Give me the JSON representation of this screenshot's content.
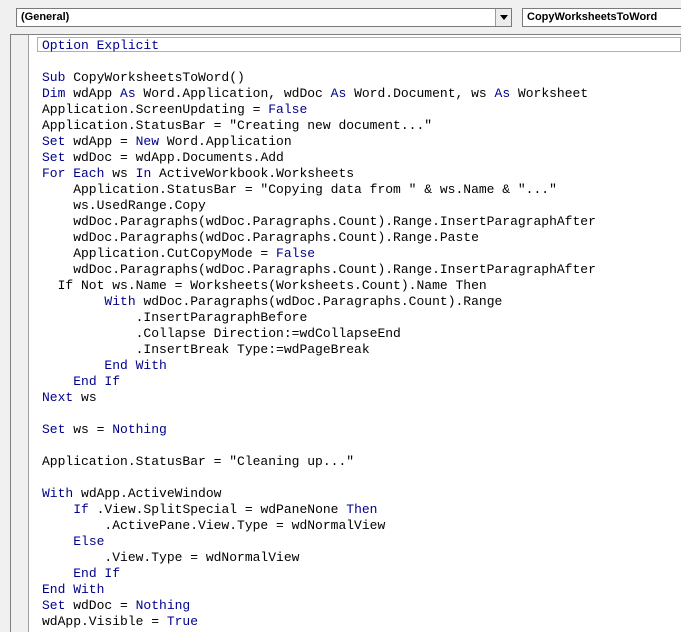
{
  "object_combo": {
    "value": "(General)"
  },
  "procedure_combo": {
    "value": "CopyWorksheetsToWord"
  },
  "colors": {
    "keyword": "#00008B",
    "text": "#000000",
    "background": "#FFFFFF"
  },
  "code_lines": [
    [
      {
        "t": "Option Explicit",
        "k": true
      }
    ],
    [],
    [
      {
        "t": "Sub",
        "k": true
      },
      {
        "t": " CopyWorksheetsToWord()"
      }
    ],
    [
      {
        "t": "Dim",
        "k": true
      },
      {
        "t": " wdApp "
      },
      {
        "t": "As",
        "k": true
      },
      {
        "t": " Word.Application, wdDoc "
      },
      {
        "t": "As",
        "k": true
      },
      {
        "t": " Word.Document, ws "
      },
      {
        "t": "As",
        "k": true
      },
      {
        "t": " Worksheet"
      }
    ],
    [
      {
        "t": "Application.ScreenUpdating = "
      },
      {
        "t": "False",
        "k": true
      }
    ],
    [
      {
        "t": "Application.StatusBar = \"Creating new document...\""
      }
    ],
    [
      {
        "t": "Set",
        "k": true
      },
      {
        "t": " wdApp = "
      },
      {
        "t": "New",
        "k": true
      },
      {
        "t": " Word.Application"
      }
    ],
    [
      {
        "t": "Set",
        "k": true
      },
      {
        "t": " wdDoc = wdApp.Documents.Add"
      }
    ],
    [
      {
        "t": "For Each",
        "k": true
      },
      {
        "t": " ws "
      },
      {
        "t": "In",
        "k": true
      },
      {
        "t": " ActiveWorkbook.Worksheets"
      }
    ],
    [
      {
        "t": "    Application.StatusBar = \"Copying data from \" & ws.Name & \"...\""
      }
    ],
    [
      {
        "t": "    ws.UsedRange.Copy"
      }
    ],
    [
      {
        "t": "    wdDoc.Paragraphs(wdDoc.Paragraphs.Count).Range.InsertParagraphAfter"
      }
    ],
    [
      {
        "t": "    wdDoc.Paragraphs(wdDoc.Paragraphs.Count).Range.Paste"
      }
    ],
    [
      {
        "t": "    Application.CutCopyMode = "
      },
      {
        "t": "False",
        "k": true
      }
    ],
    [
      {
        "t": "    wdDoc.Paragraphs(wdDoc.Paragraphs.Count).Range.InsertParagraphAfter"
      }
    ],
    [
      {
        "t": "  If Not ws.Name = Worksheets(Worksheets.Count).Name Then"
      }
    ],
    [
      {
        "t": "        "
      },
      {
        "t": "With",
        "k": true
      },
      {
        "t": " wdDoc.Paragraphs(wdDoc.Paragraphs.Count).Range"
      }
    ],
    [
      {
        "t": "            .InsertParagraphBefore"
      }
    ],
    [
      {
        "t": "            .Collapse Direction:=wdCollapseEnd"
      }
    ],
    [
      {
        "t": "            .InsertBreak Type:=wdPageBreak"
      }
    ],
    [
      {
        "t": "        "
      },
      {
        "t": "End With",
        "k": true
      }
    ],
    [
      {
        "t": "    "
      },
      {
        "t": "End If",
        "k": true
      }
    ],
    [
      {
        "t": "Next",
        "k": true
      },
      {
        "t": " ws"
      }
    ],
    [],
    [
      {
        "t": "Set",
        "k": true
      },
      {
        "t": " ws = "
      },
      {
        "t": "Nothing",
        "k": true
      }
    ],
    [],
    [
      {
        "t": "Application.StatusBar = \"Cleaning up...\""
      }
    ],
    [],
    [
      {
        "t": "With",
        "k": true
      },
      {
        "t": " wdApp.ActiveWindow"
      }
    ],
    [
      {
        "t": "    "
      },
      {
        "t": "If",
        "k": true
      },
      {
        "t": " .View.SplitSpecial = wdPaneNone "
      },
      {
        "t": "Then",
        "k": true
      }
    ],
    [
      {
        "t": "        .ActivePane.View.Type = wdNormalView"
      }
    ],
    [
      {
        "t": "    "
      },
      {
        "t": "Else",
        "k": true
      }
    ],
    [
      {
        "t": "        .View.Type = wdNormalView"
      }
    ],
    [
      {
        "t": "    "
      },
      {
        "t": "End If",
        "k": true
      }
    ],
    [
      {
        "t": "End With",
        "k": true
      }
    ],
    [
      {
        "t": "Set",
        "k": true
      },
      {
        "t": " wdDoc = "
      },
      {
        "t": "Nothing",
        "k": true
      }
    ],
    [
      {
        "t": "wdApp.Visible = "
      },
      {
        "t": "True",
        "k": true
      }
    ]
  ]
}
